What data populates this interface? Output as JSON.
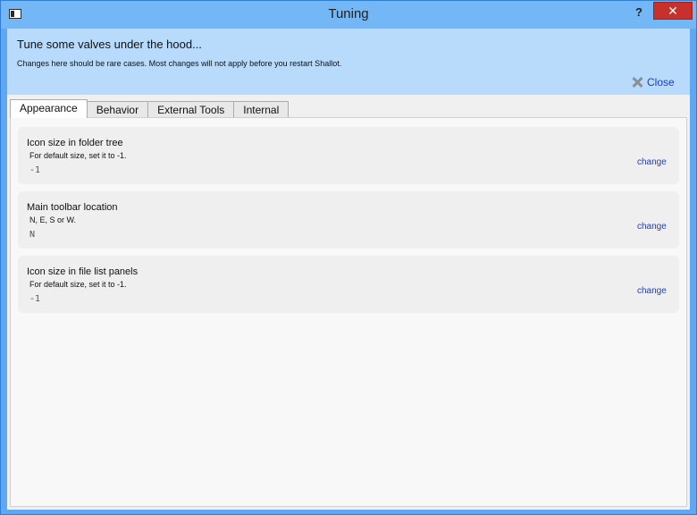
{
  "window": {
    "title": "Tuning",
    "help_label": "?",
    "close_label": "✕"
  },
  "header": {
    "title": "Tune some valves under the hood...",
    "subtitle": "Changes here should be rare cases. Most changes will not apply before you restart Shallot.",
    "close_label": "Close"
  },
  "tabs": [
    {
      "label": "Appearance",
      "active": true
    },
    {
      "label": "Behavior",
      "active": false
    },
    {
      "label": "External Tools",
      "active": false
    },
    {
      "label": "Internal",
      "active": false
    }
  ],
  "settings": [
    {
      "title": "Icon size in folder tree",
      "description": "For default size, set it to -1.",
      "value": "-1",
      "action": "change"
    },
    {
      "title": "Main toolbar location",
      "description": "N, E, S or W.",
      "value": "N",
      "action": "change"
    },
    {
      "title": "Icon size in file list panels",
      "description": "For default size, set it to -1.",
      "value": "-1",
      "action": "change"
    }
  ]
}
